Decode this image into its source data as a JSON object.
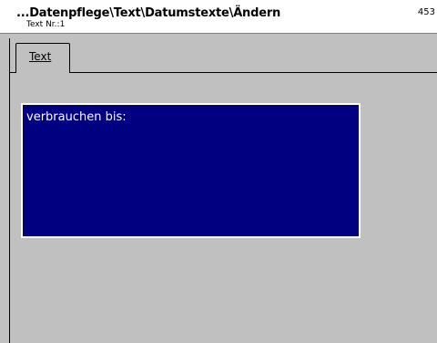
{
  "header": {
    "title": "...Datenpflege\\Text\\Datumstexte\\Ändern",
    "subtitle": "Text Nr.:1",
    "code": "453"
  },
  "tabs": [
    {
      "label": "Text",
      "active": true
    }
  ],
  "editor": {
    "value": "verbrauchen bis:",
    "background": "#000080",
    "text_color": "#ffffff"
  }
}
